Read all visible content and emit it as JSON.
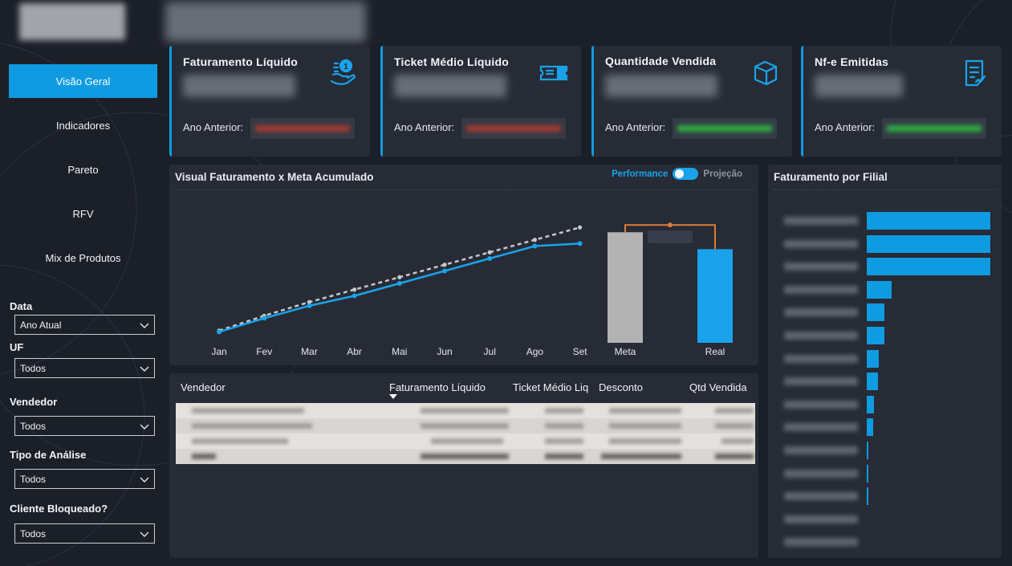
{
  "nav": {
    "items": [
      {
        "label": "Visão Geral",
        "active": true
      },
      {
        "label": "Indicadores",
        "active": false
      },
      {
        "label": "Pareto",
        "active": false
      },
      {
        "label": "RFV",
        "active": false
      },
      {
        "label": "Mix de Produtos",
        "active": false
      }
    ]
  },
  "filters": [
    {
      "label": "Data",
      "value": "Ano Atual"
    },
    {
      "label": "UF",
      "value": "Todos"
    },
    {
      "label": "Vendedor",
      "value": "Todos"
    },
    {
      "label": "Tipo de Análise",
      "value": "Todos"
    },
    {
      "label": "Cliente Bloqueado?",
      "value": "Todos"
    }
  ],
  "kpis": [
    {
      "title": "Faturamento Líquido",
      "prev_label": "Ano Anterior:",
      "icon": "money-hand-icon",
      "prev_color": "#c0392b"
    },
    {
      "title": "Ticket Médio Líquido",
      "prev_label": "Ano Anterior:",
      "icon": "ticket-icon",
      "prev_color": "#c0392b"
    },
    {
      "title": "Quantidade Vendida",
      "prev_label": "Ano Anterior:",
      "icon": "box-icon",
      "prev_color": "#2ecc40"
    },
    {
      "title": "Nf-e Emitidas",
      "prev_label": "Ano Anterior:",
      "icon": "document-icon",
      "prev_color": "#2ecc40"
    }
  ],
  "meta_chart": {
    "title": "Visual Faturamento x Meta Acumulado",
    "toggle_left": "Performance",
    "toggle_right": "Projeção",
    "months": [
      "Jan",
      "Fev",
      "Mar",
      "Abr",
      "Mai",
      "Jun",
      "Jul",
      "Ago",
      "Set"
    ],
    "bar_labels": [
      "Meta",
      "Real"
    ]
  },
  "chart_data": {
    "type": "line",
    "categories": [
      "Jan",
      "Fev",
      "Mar",
      "Abr",
      "Mai",
      "Jun",
      "Jul",
      "Ago",
      "Set"
    ],
    "series": [
      {
        "name": "Real",
        "values": [
          1,
          12,
          22,
          30,
          40,
          50,
          60,
          70,
          72
        ]
      },
      {
        "name": "Meta",
        "values": [
          2,
          14,
          25,
          35,
          45,
          55,
          65,
          75,
          85
        ]
      }
    ],
    "waterfall": {
      "categories": [
        "Meta",
        "Real"
      ],
      "values": [
        85,
        72
      ]
    },
    "colors": {
      "real": "#1aa3ea",
      "meta": "#c8c8c8",
      "meta_bar": "#b3b3b3",
      "connector": "#e07b39"
    }
  },
  "table": {
    "headers": [
      "Vendedor",
      "Faturamento Líquido",
      "Ticket Médio Liq",
      "Desconto",
      "Qtd Vendida"
    ],
    "row_count": 4
  },
  "filial": {
    "title": "Faturamento por Filial",
    "values": [
      100,
      100,
      100,
      20,
      14,
      14,
      10,
      9,
      6,
      5,
      1,
      1,
      1,
      0,
      0
    ]
  }
}
